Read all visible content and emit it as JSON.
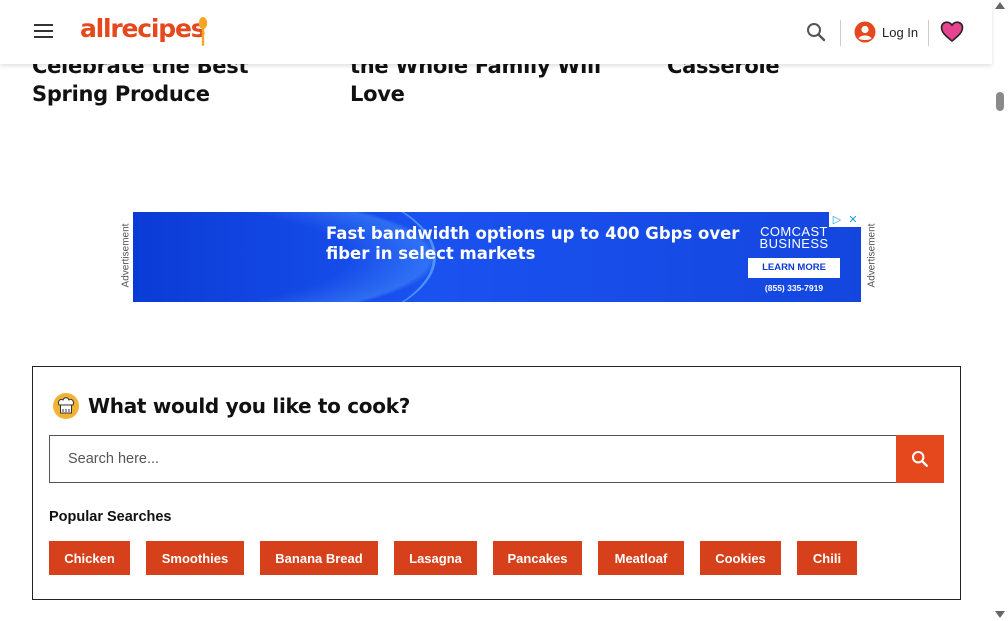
{
  "articles": [
    {
      "title": "Celebrate the Best Spring Produce"
    },
    {
      "title": "the Whole Family Will Love"
    },
    {
      "title": "Casserole"
    }
  ],
  "header": {
    "logo_text": "allrecipes",
    "login_label": "Log In",
    "icons": {
      "menu": "hamburger-icon",
      "search": "search-icon",
      "account": "account-circle-icon",
      "favorites": "heart-icon"
    }
  },
  "ad": {
    "side_label": "Advertisement",
    "headline": "Fast bandwidth options up to 400 Gbps over fiber in select markets",
    "brand_line1": "COMCAST",
    "brand_line2": "BUSINESS",
    "cta": "LEARN MORE",
    "phone": "(855) 335-7919",
    "choices_icon": "adchoices-icon",
    "close_icon": "close-icon"
  },
  "cook_search": {
    "title": "What would you like to cook?",
    "placeholder": "Search here...",
    "value": "",
    "popular_label": "Popular Searches",
    "popular": [
      "Chicken",
      "Smoothies",
      "Banana Bread",
      "Lasagna",
      "Pancakes",
      "Meatloaf",
      "Cookies",
      "Chili"
    ]
  },
  "colors": {
    "brand": "#e4481c",
    "chip": "#d6401a",
    "ad_blue": "#0b3bd6",
    "favorite_pink": "#e84393"
  }
}
